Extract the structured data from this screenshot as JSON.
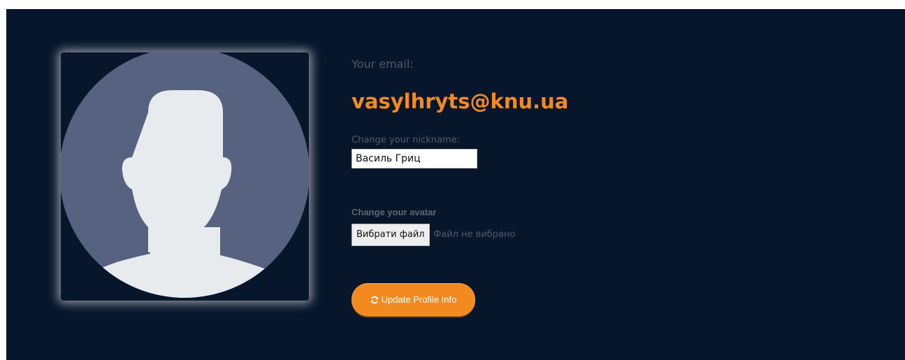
{
  "profile": {
    "email_label": "Your email:",
    "email": "vasylhryts@knu.ua",
    "nickname_label": "Change your nickname:",
    "nickname_value": "Василь Гриц",
    "avatar_label": "Change your avatar",
    "file_button_label": "Вибрати файл",
    "file_status": "Файл не вибрано",
    "update_button_label": "Update Profile Info",
    "update_button_icon": "refresh-icon",
    "avatar_icon": "default-user-silhouette-icon"
  },
  "colors": {
    "background": "#08162c",
    "accent": "#f28a1f",
    "muted_text": "#4b5a72",
    "avatar_circle": "#56627f",
    "avatar_figure": "#e7ebee"
  }
}
